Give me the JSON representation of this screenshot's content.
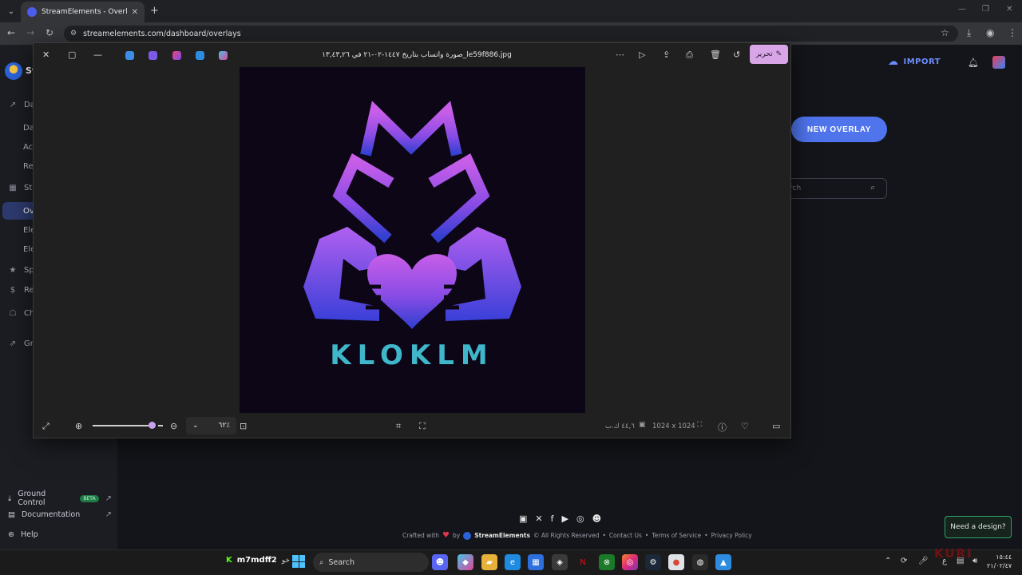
{
  "browser": {
    "tab_title": "StreamElements - Overlays",
    "url": "streamelements.com/dashboard/overlays"
  },
  "sidebar": {
    "brand": "St",
    "items": [
      {
        "label": "Da",
        "icon": "chart-line-icon",
        "type": "section"
      },
      {
        "label": "Da",
        "icon": "",
        "type": "sub"
      },
      {
        "label": "Ac",
        "icon": "",
        "type": "sub"
      },
      {
        "label": "Re",
        "icon": "",
        "type": "sub"
      },
      {
        "label": "Str",
        "icon": "layout-icon",
        "type": "section"
      },
      {
        "label": "Ov",
        "icon": "",
        "type": "sub-active"
      },
      {
        "label": "Ele",
        "icon": "",
        "type": "sub"
      },
      {
        "label": "Ele",
        "icon": "",
        "type": "sub"
      },
      {
        "label": "Sp",
        "icon": "star-icon",
        "type": "section"
      },
      {
        "label": "Re",
        "icon": "dollar-icon",
        "type": "section"
      },
      {
        "label": "Ch",
        "icon": "robot-icon",
        "type": "section"
      },
      {
        "label": "Gr",
        "icon": "growth-icon",
        "type": "section"
      }
    ],
    "bottom_links": [
      {
        "label": "Ground Control",
        "badge": "BETA",
        "icon": "download-icon"
      },
      {
        "label": "Documentation",
        "badge": "",
        "icon": "doc-icon"
      },
      {
        "label": "Help",
        "badge": "",
        "icon": "help-icon"
      }
    ]
  },
  "header": {
    "import_label": "IMPORT"
  },
  "main": {
    "new_overlay_label": "NEW OVERLAY",
    "search_placeholder": "rch"
  },
  "footer": {
    "crafted_with": "Crafted with",
    "by": "by",
    "brand": "StreamElements",
    "rights": "© All Rights Reserved",
    "contact": "Contact Us",
    "terms": "Terms of Service",
    "privacy": "Privacy Policy",
    "social_icons": [
      "twitch-icon",
      "x-icon",
      "facebook-icon",
      "youtube-icon",
      "instagram-icon",
      "discord-icon"
    ]
  },
  "need_design_label": "Need a design?",
  "viewer": {
    "title": "صورة واتساب بتاريخ ١٤٤٧-٠٢-٢١ في ١٣,٤٣,٢٦_le59f886.jpg",
    "edit_label": "تحرير",
    "zoom_value": "٦٢٪",
    "file_size": "٤٤,٦ ك.ب",
    "dimensions": "1024 x 1024",
    "image_text": "KLOKLM"
  },
  "taskbar": {
    "user_name": "m7mdff2",
    "user_note": "خو",
    "search_label": "Search",
    "time": "١٥:٤٤",
    "date": "٢١/٠٢/٤٧",
    "lang": "ع",
    "watermark": "KURI"
  },
  "colors": {
    "accent": "#4f74ec",
    "edit_button": "#d8a6e6",
    "logo_purple": "#c45ee8",
    "logo_blue": "#2f3fd0",
    "logo_teal": "#3fb6c9"
  }
}
